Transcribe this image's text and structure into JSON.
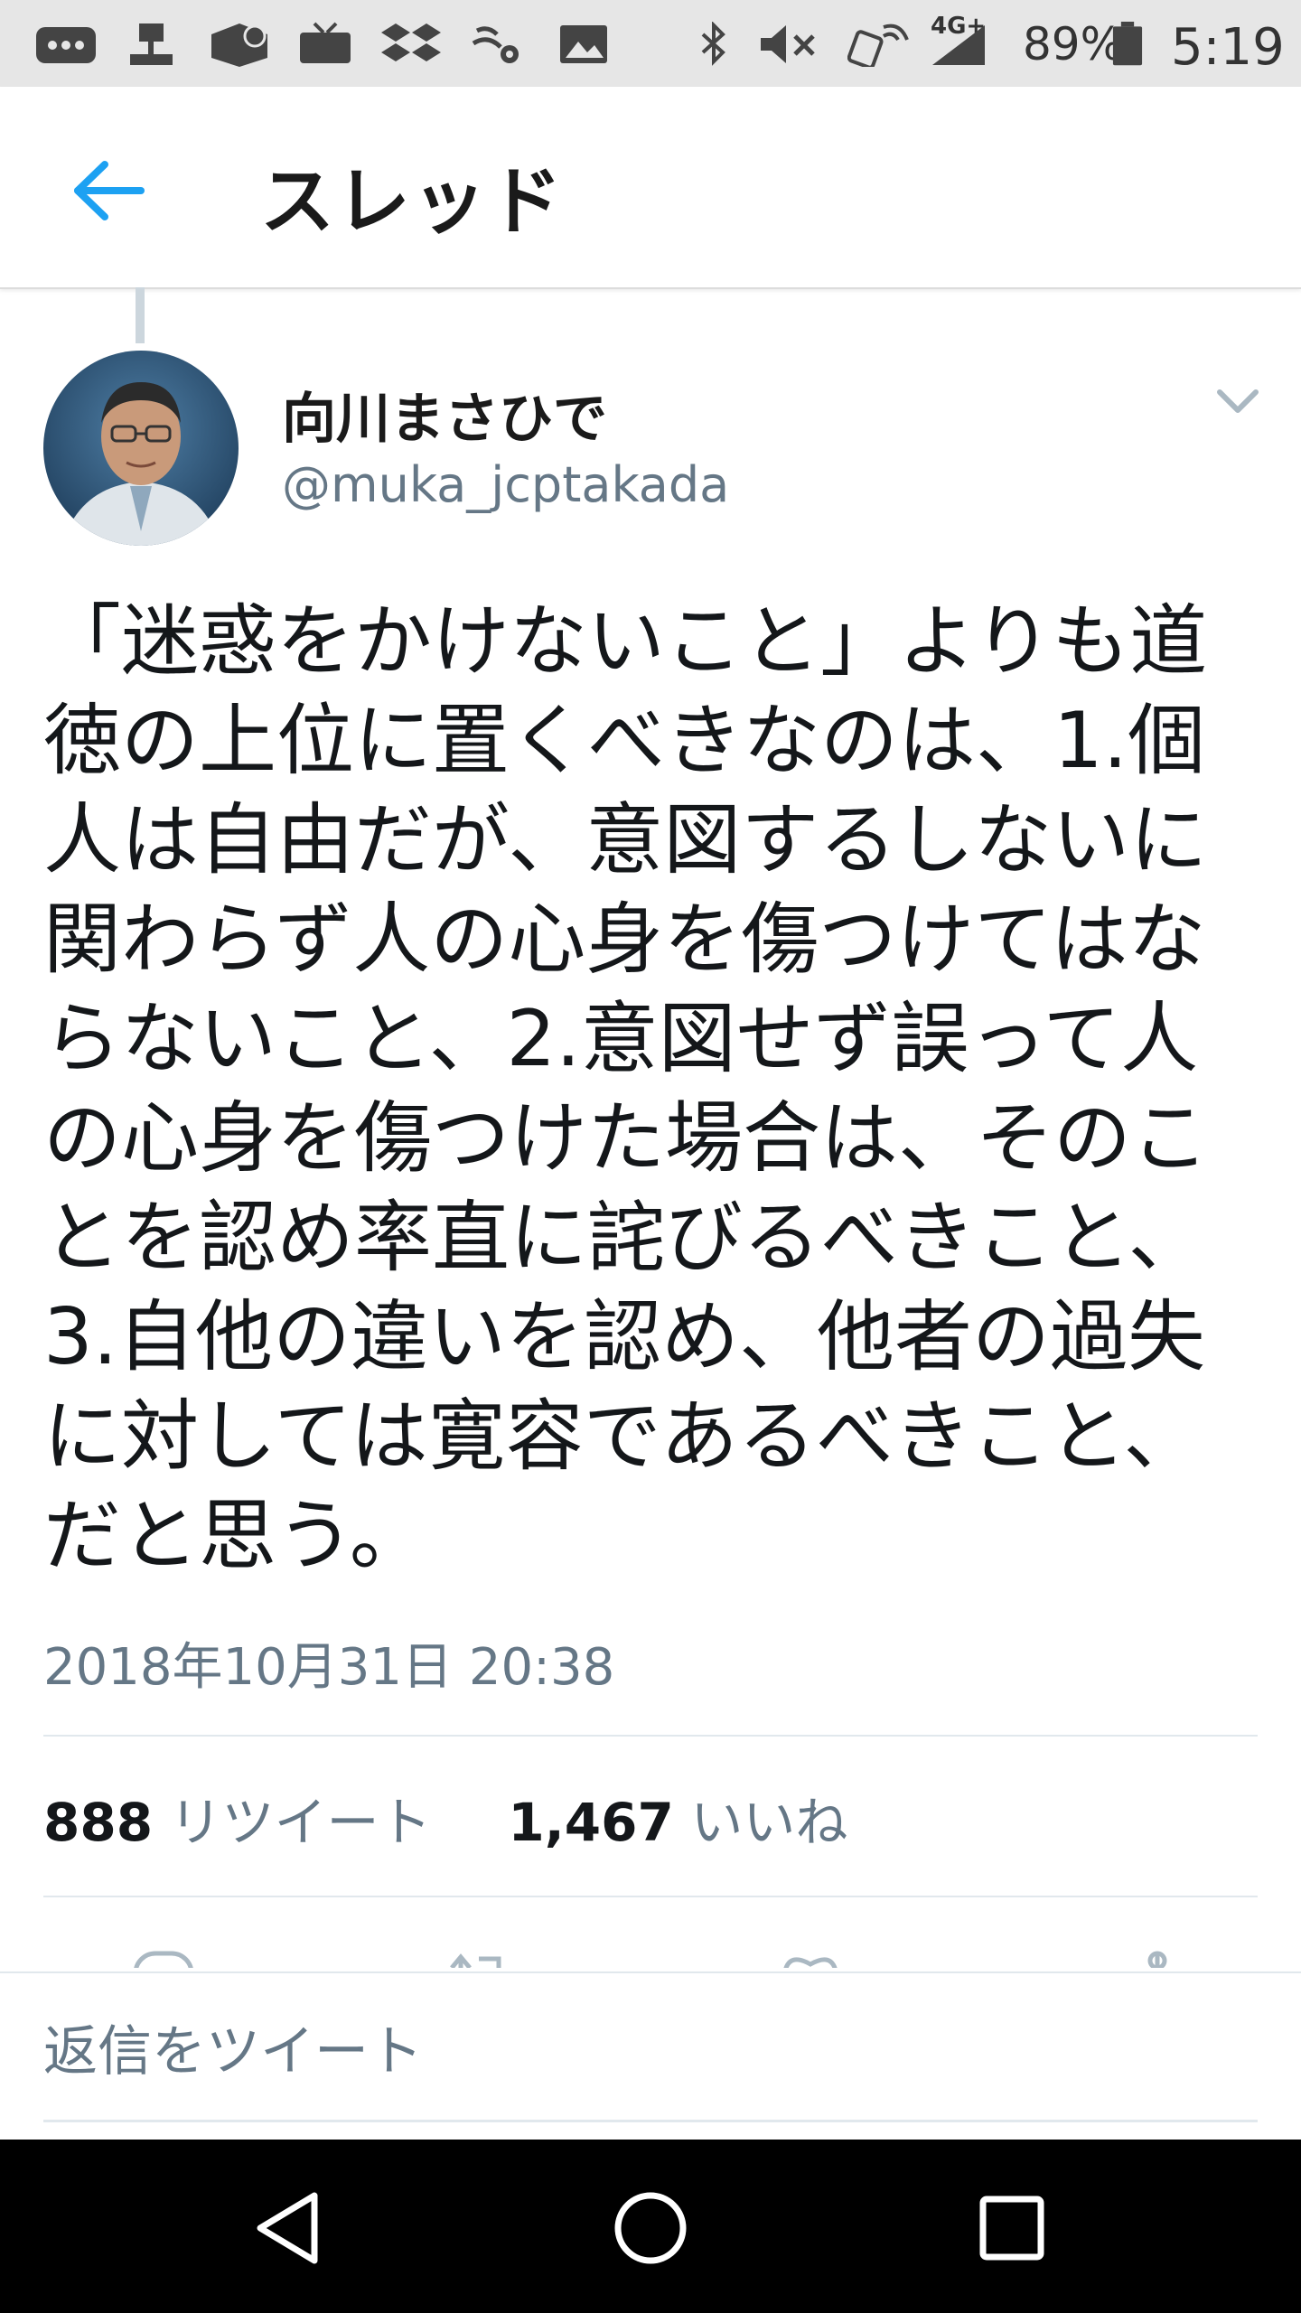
{
  "status_bar": {
    "battery": "89%",
    "time": "5:19",
    "network": "4G+",
    "icons": [
      "chat-icon",
      "notification-icon",
      "app-icon",
      "tv-icon",
      "dropbox-icon",
      "settings-icon",
      "gallery-icon",
      "bluetooth-icon",
      "mute-icon",
      "nfc-icon",
      "signal-icon",
      "battery-icon"
    ]
  },
  "header": {
    "title": "スレッド",
    "back_icon": "arrow-left-icon",
    "accent": "#1da1f2"
  },
  "tweet": {
    "author_name": "向川まさひで",
    "author_handle": "@muka_jcptakada",
    "text": "「迷惑をかけないこと」よりも道徳の上位に置くべきなのは、1.個人は自由だが、意図するしないに関わらず人の心身を傷つけてはならないこと、2.意図せず誤って人の心身を傷つけた場合は、そのことを認め率直に詫びるべきこと、3.自他の違いを認め、他者の過失に対しては寛容であるべきこと、だと思う。",
    "timestamp": "2018年10月31日 20:38",
    "retweet_count": "888",
    "retweet_label": "リツイート",
    "like_count": "1,467",
    "like_label": "いいね"
  },
  "reply": {
    "placeholder": "返信をツイート"
  },
  "nav": {
    "back_icon": "triangle-back-icon",
    "home_icon": "circle-home-icon",
    "recents_icon": "square-recents-icon"
  }
}
